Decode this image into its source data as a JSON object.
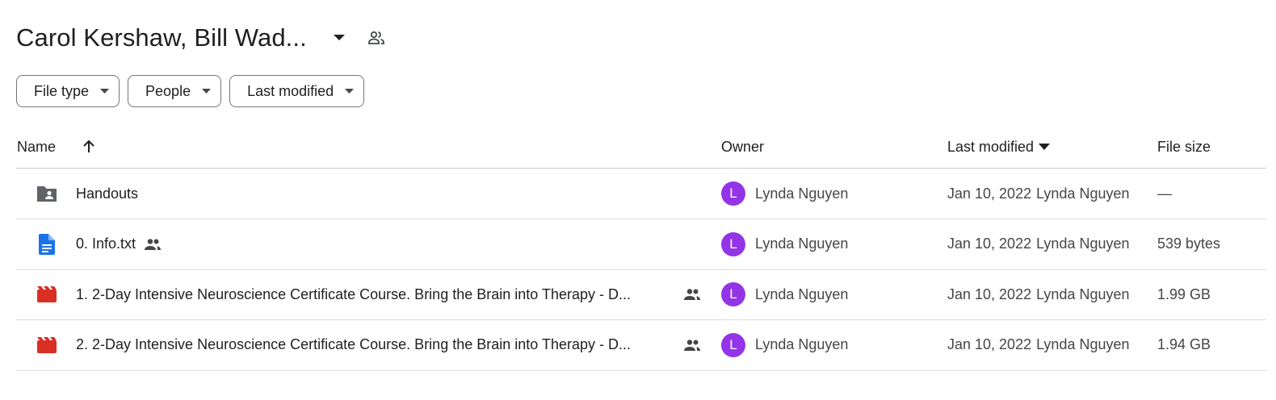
{
  "header": {
    "title": "Carol Kershaw, Bill Wad...",
    "title_menu_icon": "caret-down-icon",
    "share_icon": "people-outline-icon"
  },
  "filters": [
    {
      "label": "File type"
    },
    {
      "label": "People"
    },
    {
      "label": "Last modified"
    }
  ],
  "columns": {
    "name": "Name",
    "owner": "Owner",
    "last_modified": "Last modified",
    "file_size": "File size",
    "name_sort": "ascending",
    "modified_sort": "descending"
  },
  "files": [
    {
      "icon": "shared-folder-icon",
      "name": "Handouts",
      "shared": false,
      "owner_initial": "L",
      "owner": "Lynda Nguyen",
      "modified_date": "Jan 10, 2022",
      "modified_by": "Lynda Nguyen",
      "size": "—"
    },
    {
      "icon": "text-doc-icon",
      "name": "0. Info.txt",
      "shared": true,
      "owner_initial": "L",
      "owner": "Lynda Nguyen",
      "modified_date": "Jan 10, 2022",
      "modified_by": "Lynda Nguyen",
      "size": "539 bytes"
    },
    {
      "icon": "video-file-icon",
      "name": "1. 2-Day Intensive Neuroscience Certificate Course.  Bring the Brain into Therapy - D...",
      "shared": true,
      "owner_initial": "L",
      "owner": "Lynda Nguyen",
      "modified_date": "Jan 10, 2022",
      "modified_by": "Lynda Nguyen",
      "size": "1.99 GB"
    },
    {
      "icon": "video-file-icon",
      "name": "2. 2-Day Intensive Neuroscience Certificate Course.  Bring the Brain into Therapy - D...",
      "shared": true,
      "owner_initial": "L",
      "owner": "Lynda Nguyen",
      "modified_date": "Jan 10, 2022",
      "modified_by": "Lynda Nguyen",
      "size": "1.94 GB"
    }
  ],
  "colors": {
    "avatar": "#9334e6",
    "doc_icon": "#1a73e8",
    "video_icon": "#d93025",
    "folder_icon": "#5f6368"
  }
}
